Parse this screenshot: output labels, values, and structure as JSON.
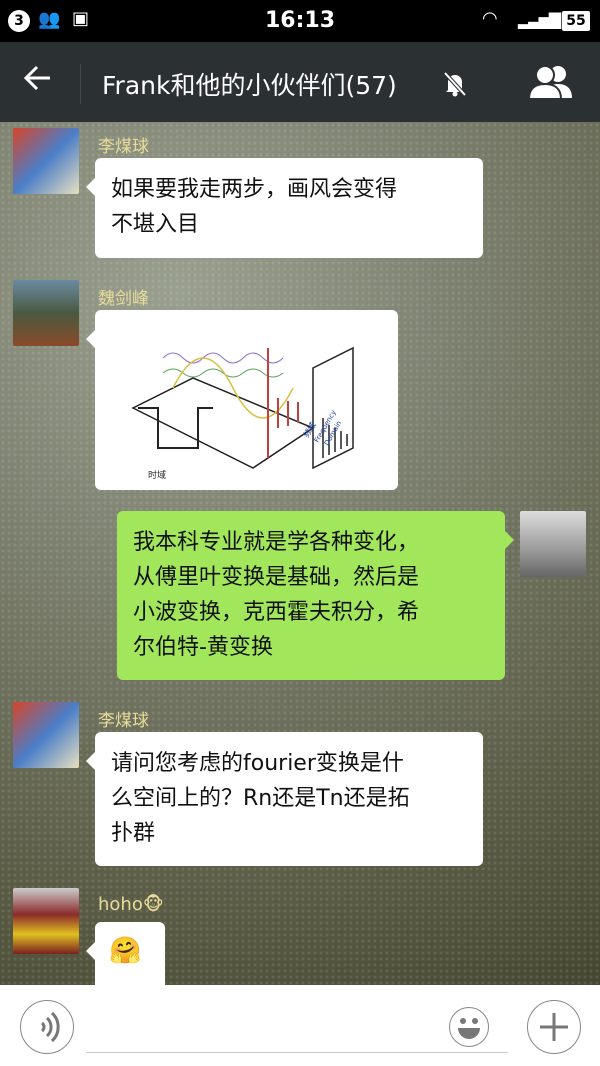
{
  "status_bar": {
    "notification_count": "3",
    "time": "16:13",
    "battery": "55"
  },
  "header": {
    "title": "Frank和他的小伙伴们(57)",
    "back_icon": "arrow-left-icon",
    "mute_icon": "bell-muted-icon",
    "members_icon": "group-icon"
  },
  "messages": [
    {
      "side": "left",
      "sender": "李煤球",
      "lines": [
        "如果要我走两步，画风会变得",
        "不堪入目"
      ]
    },
    {
      "side": "left",
      "sender": "魏剑峰",
      "image": {
        "labels": [
          "时域",
          "频域",
          "Frequency",
          "Domain"
        ]
      }
    },
    {
      "side": "right",
      "lines": [
        "我本科专业就是学各种变化，",
        "从傅里叶变换是基础，然后是",
        "小波变换，克西霍夫积分，希",
        "尔伯特-黄变换"
      ]
    },
    {
      "side": "left",
      "sender": "李煤球",
      "lines": [
        "请问您考虑的fourier变换是什",
        "么空间上的？Rn还是Tn还是拓",
        "扑群"
      ]
    },
    {
      "side": "left",
      "sender": "hoho🐵",
      "emoji": "🤗"
    }
  ],
  "input": {
    "voice_icon": "voice-icon",
    "emoji_icon": "smiley-icon",
    "plus_icon": "plus-icon",
    "value": ""
  }
}
